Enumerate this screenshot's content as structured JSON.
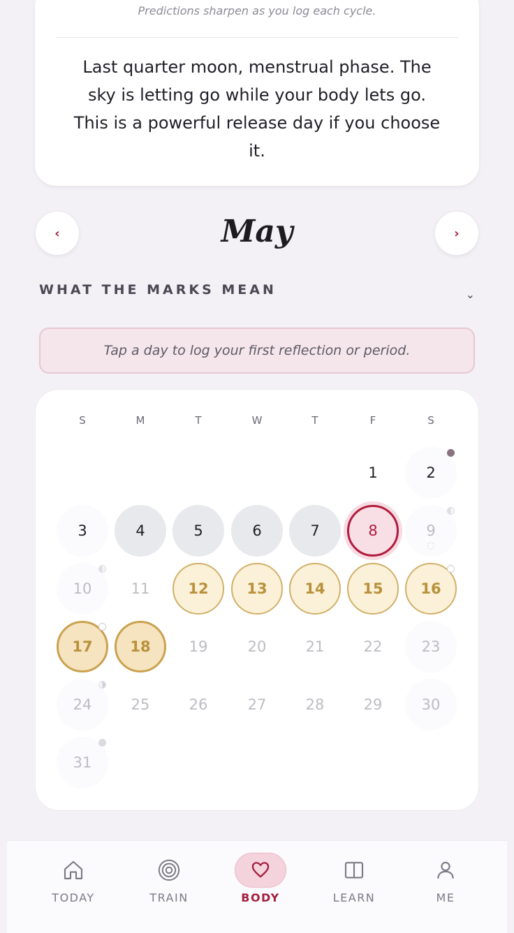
{
  "top_card": {
    "note": "Predictions sharpen as you log each cycle.",
    "reflection_lines": [
      "Last quarter moon, menstrual phase. The",
      "sky is letting go while your body lets go.",
      "This is a powerful release day if you choose",
      "it."
    ]
  },
  "month_nav": {
    "prev_icon": "‹",
    "next_icon": "›",
    "month": "May"
  },
  "legend": {
    "label": "WHAT THE MARKS MEAN",
    "chevron": "⌄"
  },
  "hint": "Tap a day to log your first reflection or period.",
  "calendar": {
    "weekdays": [
      "S",
      "M",
      "T",
      "W",
      "T",
      "F",
      "S"
    ],
    "days": [
      {
        "n": "1",
        "state": "normal"
      },
      {
        "n": "2",
        "state": "plain",
        "moon": "full"
      },
      {
        "n": "3",
        "state": "plain"
      },
      {
        "n": "4",
        "state": "grey"
      },
      {
        "n": "5",
        "state": "grey"
      },
      {
        "n": "6",
        "state": "grey"
      },
      {
        "n": "7",
        "state": "grey"
      },
      {
        "n": "8",
        "state": "today"
      },
      {
        "n": "9",
        "state": "faint",
        "moon": "half",
        "drop": true
      },
      {
        "n": "10",
        "state": "faint",
        "moon": "half"
      },
      {
        "n": "11",
        "state": "faint-nobg"
      },
      {
        "n": "12",
        "state": "gold"
      },
      {
        "n": "13",
        "state": "gold"
      },
      {
        "n": "14",
        "state": "gold"
      },
      {
        "n": "15",
        "state": "gold"
      },
      {
        "n": "16",
        "state": "gold",
        "moon": "new"
      },
      {
        "n": "17",
        "state": "gold-strong",
        "moon": "new"
      },
      {
        "n": "18",
        "state": "gold-strong"
      },
      {
        "n": "19",
        "state": "faint-nobg"
      },
      {
        "n": "20",
        "state": "faint-nobg"
      },
      {
        "n": "21",
        "state": "faint-nobg"
      },
      {
        "n": "22",
        "state": "faint-nobg"
      },
      {
        "n": "23",
        "state": "faint"
      },
      {
        "n": "24",
        "state": "faint",
        "moon": "half-r"
      },
      {
        "n": "25",
        "state": "faint-nobg"
      },
      {
        "n": "26",
        "state": "faint-nobg"
      },
      {
        "n": "27",
        "state": "faint-nobg"
      },
      {
        "n": "28",
        "state": "faint-nobg"
      },
      {
        "n": "29",
        "state": "faint-nobg"
      },
      {
        "n": "30",
        "state": "faint"
      },
      {
        "n": "31",
        "state": "faint",
        "moon": "light"
      }
    ]
  },
  "tabs": [
    {
      "label": "TODAY",
      "icon": "home-icon",
      "active": false
    },
    {
      "label": "TRAIN",
      "icon": "target-icon",
      "active": false
    },
    {
      "label": "BODY",
      "icon": "heart-icon",
      "active": true
    },
    {
      "label": "LEARN",
      "icon": "book-icon",
      "active": false
    },
    {
      "label": "ME",
      "icon": "person-icon",
      "active": false
    }
  ],
  "colors": {
    "accent": "#a3203f",
    "gold": "#caa24f",
    "background": "#f3f1f6"
  }
}
